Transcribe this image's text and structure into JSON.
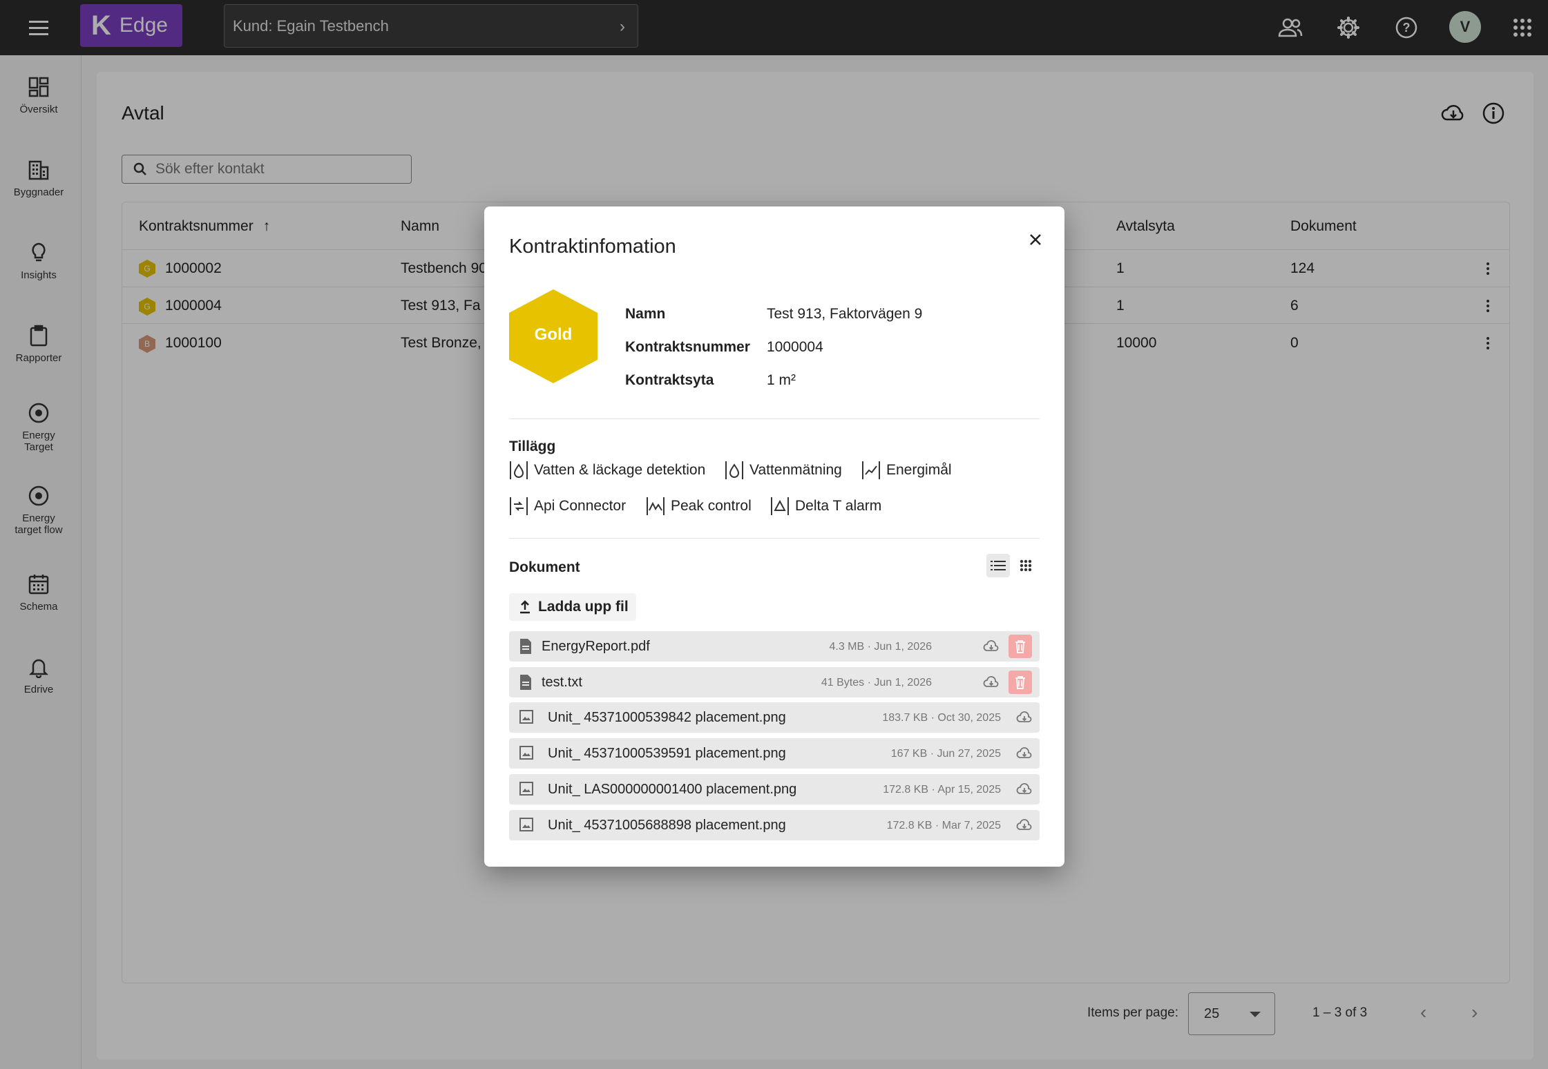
{
  "topbar": {
    "logo_letter": "K",
    "logo_text": "Edge",
    "customer_label": "Kund: Egain Testbench",
    "avatar_initial": "V",
    "brand_color": "#7a3fbf"
  },
  "sidebar": {
    "items": [
      {
        "label": "Översikt",
        "icon": "dashboard-icon"
      },
      {
        "label": "Byggnader",
        "icon": "building-icon"
      },
      {
        "label": "Insights",
        "icon": "lightbulb-icon"
      },
      {
        "label": "Rapporter",
        "icon": "clipboard-icon"
      },
      {
        "label": "Energy Target",
        "icon": "target-icon"
      },
      {
        "label": "Energy target flow",
        "icon": "target-flow-icon"
      },
      {
        "label": "Schema",
        "icon": "calendar-icon"
      },
      {
        "label": "Edrive",
        "icon": "bell-icon"
      }
    ]
  },
  "page": {
    "title": "Avtal",
    "search_placeholder": "Sök efter kontakt"
  },
  "table": {
    "headers": [
      "Kontraktsnummer",
      "Namn",
      "Avtalsyta",
      "Dokument"
    ],
    "rows": [
      {
        "badge": "G",
        "number": "1000002",
        "name": "Testbench 90",
        "area": "1",
        "docs": "124"
      },
      {
        "badge": "G",
        "number": "1000004",
        "name": "Test 913, Fa",
        "area": "1",
        "docs": "6"
      },
      {
        "badge": "B",
        "number": "1000100",
        "name": "Test Bronze,",
        "area": "10000",
        "docs": "0"
      }
    ]
  },
  "paginator": {
    "items_per_page_label": "Items per page:",
    "page_size": "25",
    "range": "1 – 3 of 3"
  },
  "modal": {
    "title": "Kontraktinfomation",
    "tier": "Gold",
    "tier_color": "#e6c200",
    "fields": [
      {
        "key": "Namn",
        "value": "Test 913, Faktorvägen 9"
      },
      {
        "key": "Kontraktsnummer",
        "value": "1000004"
      },
      {
        "key": "Kontraktsyta",
        "value": "1 m²"
      }
    ],
    "addons_title": "Tillägg",
    "addons": [
      {
        "label": "Vatten & läckage detektion",
        "icon": "water-drop-icon"
      },
      {
        "label": "Vattenmätning",
        "icon": "water-drop-icon"
      },
      {
        "label": "Energimål",
        "icon": "chart-trend-icon"
      },
      {
        "label": "Api Connector",
        "icon": "api-connector-icon"
      },
      {
        "label": "Peak control",
        "icon": "peak-icon"
      },
      {
        "label": "Delta T alarm",
        "icon": "delta-icon"
      }
    ],
    "documents_title": "Dokument",
    "upload_label": "Ladda upp fil",
    "files": [
      {
        "name": "EnergyReport.pdf",
        "meta": "4.3 MB · Jun 1, 2026",
        "type": "document",
        "deletable": true
      },
      {
        "name": "test.txt",
        "meta": "41 Bytes · Jun 1, 2026",
        "type": "document",
        "deletable": true
      },
      {
        "name": "Unit_ 45371000539842 placement.png",
        "meta": "183.7 KB · Oct 30, 2025",
        "type": "image",
        "deletable": false
      },
      {
        "name": "Unit_ 45371000539591 placement.png",
        "meta": "167 KB · Jun 27, 2025",
        "type": "image",
        "deletable": false
      },
      {
        "name": "Unit_ LAS000000001400 placement.png",
        "meta": "172.8 KB · Apr 15, 2025",
        "type": "image",
        "deletable": false
      },
      {
        "name": "Unit_ 45371005688898 placement.png",
        "meta": "172.8 KB · Mar 7, 2025",
        "type": "image",
        "deletable": false
      }
    ]
  }
}
